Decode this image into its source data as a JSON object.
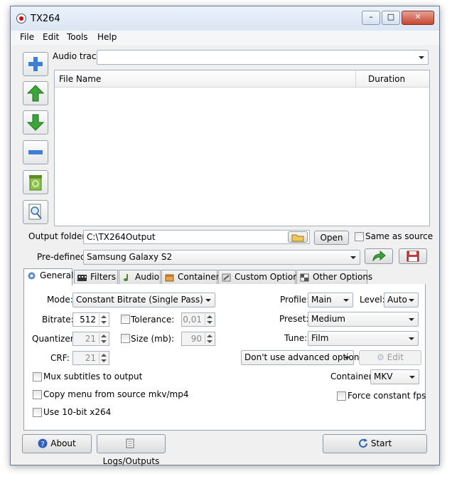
{
  "window": {
    "title": "TX264"
  },
  "window_controls": {
    "minimize": "–",
    "maximize": "□",
    "close": "✕"
  },
  "menu": {
    "items": [
      "File",
      "Edit",
      "Tools",
      "Help"
    ]
  },
  "audio": {
    "label": "Audio track:",
    "value": ""
  },
  "file_list": {
    "columns": [
      "File Name",
      "Duration"
    ],
    "rows": []
  },
  "output": {
    "label": "Output folder:",
    "value": "C:\\TX264Output",
    "open_label": "Open",
    "same_as_source_label": "Same as source"
  },
  "predefined": {
    "label": "Pre-defined:",
    "value": "Samsung Galaxy S2"
  },
  "tabs": [
    {
      "label": "General",
      "icon": "gear-icon"
    },
    {
      "label": "Filters",
      "icon": "film-icon"
    },
    {
      "label": "Audio",
      "icon": "music-note-icon"
    },
    {
      "label": "Container",
      "icon": "box-icon"
    },
    {
      "label": "Custom Options",
      "icon": "wrench-icon"
    },
    {
      "label": "Other Options",
      "icon": "grid-icon"
    }
  ],
  "general": {
    "mode_label": "Mode:",
    "mode_value": "Constant Bitrate (Single Pass)",
    "bitrate_label": "Bitrate:",
    "bitrate_value": "512",
    "tolerance_label": "Tolerance:",
    "tolerance_value": "0,01",
    "quantizer_label": "Quantizer:",
    "quantizer_value": "21",
    "size_label": "Size (mb):",
    "size_value": "90",
    "crf_label": "CRF:",
    "crf_value": "21",
    "mux_subtitles_label": "Mux subtitles to output",
    "copy_menu_label": "Copy menu from source mkv/mp4",
    "use_10bit_label": "Use 10-bit x264",
    "profile_label": "Profile:",
    "profile_value": "Main",
    "level_label": "Level:",
    "level_value": "Auto",
    "preset_label": "Preset:",
    "preset_value": "Medium",
    "tune_label": "Tune:",
    "tune_value": "Film",
    "advanced_value": "Don't use advanced options",
    "edit_label": "Edit",
    "container_label": "Container:",
    "container_value": "MKV",
    "force_fps_label": "Force constant fps"
  },
  "footer": {
    "about_label": "About",
    "logs_label": "Logs/Outputs",
    "start_label": "Start"
  }
}
